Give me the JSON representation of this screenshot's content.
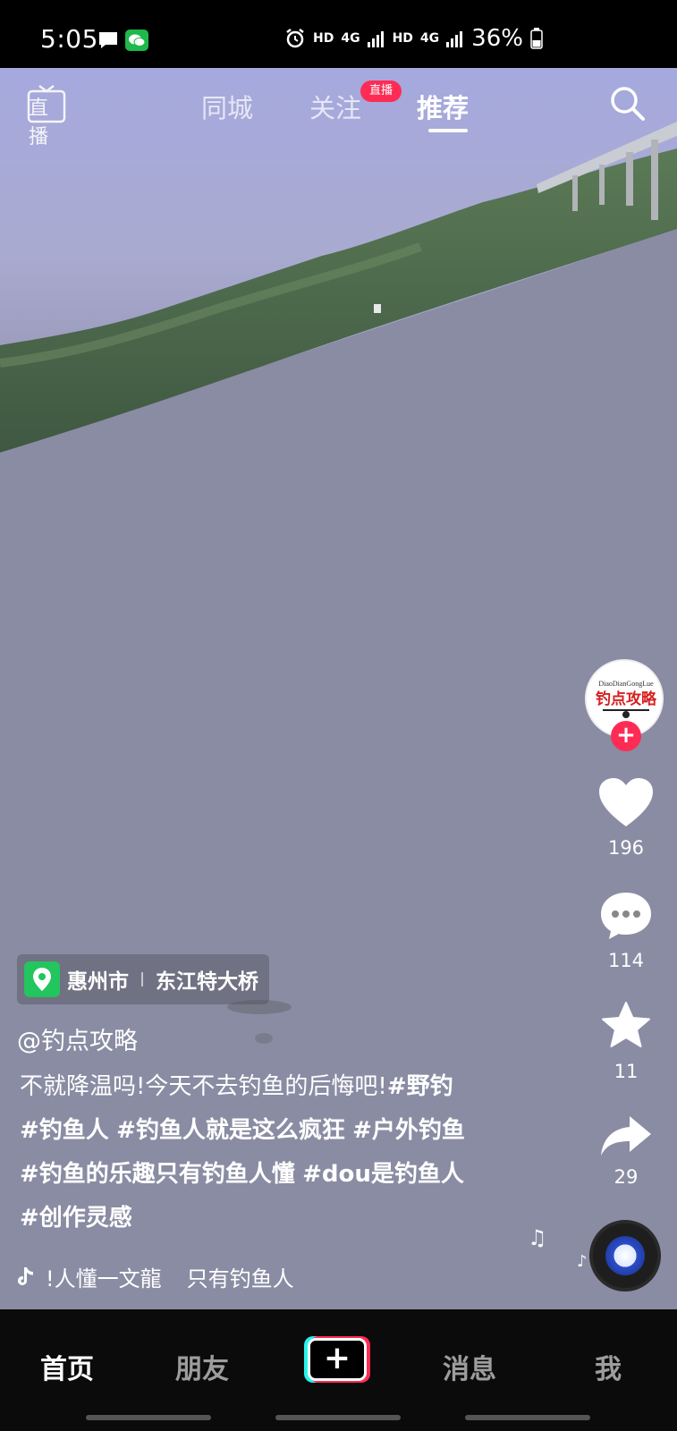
{
  "status_bar": {
    "time": "5:05",
    "network1": "HD",
    "signal1": "4G",
    "network2": "HD",
    "signal2": "4G",
    "battery": "36%",
    "icons": [
      "chat-bubble-icon",
      "wechat-icon",
      "alarm-icon",
      "signal-icon",
      "battery-icon"
    ]
  },
  "top_nav": {
    "live_label": "直播",
    "tabs": [
      {
        "label": "同城",
        "active": false
      },
      {
        "label": "关注",
        "active": false
      },
      {
        "label": "推荐",
        "active": true
      }
    ],
    "live_badge": "直播",
    "search_icon": "search-icon"
  },
  "creator": {
    "avatar_text": "钓点攻略",
    "avatar_subtext": "DiaoDianGongLue",
    "follow_icon": "plus-icon"
  },
  "actions": {
    "likes": "196",
    "comments": "114",
    "favorites": "11",
    "shares": "29"
  },
  "location": {
    "city": "惠州市",
    "place": "东江特大桥"
  },
  "post": {
    "author": "@钓点攻略",
    "caption_text": "不就降温吗!今天不去钓鱼的后悔吧!",
    "tags": [
      "#野钓",
      "#钓鱼人",
      "#钓鱼人就是这么疯狂",
      "#户外钓鱼",
      "#钓鱼的乐趣只有钓鱼人懂",
      "#dou是钓鱼人",
      "#创作灵感"
    ]
  },
  "music": {
    "title": "!人懂一文龍",
    "artist": "只有钓鱼人"
  },
  "bottom_nav": {
    "items": [
      "首页",
      "朋友",
      "消息",
      "我"
    ],
    "create_label": "+"
  },
  "colors": {
    "accent": "#fe2c55",
    "location_green": "#22c55e",
    "cyan": "#25f4ee"
  }
}
